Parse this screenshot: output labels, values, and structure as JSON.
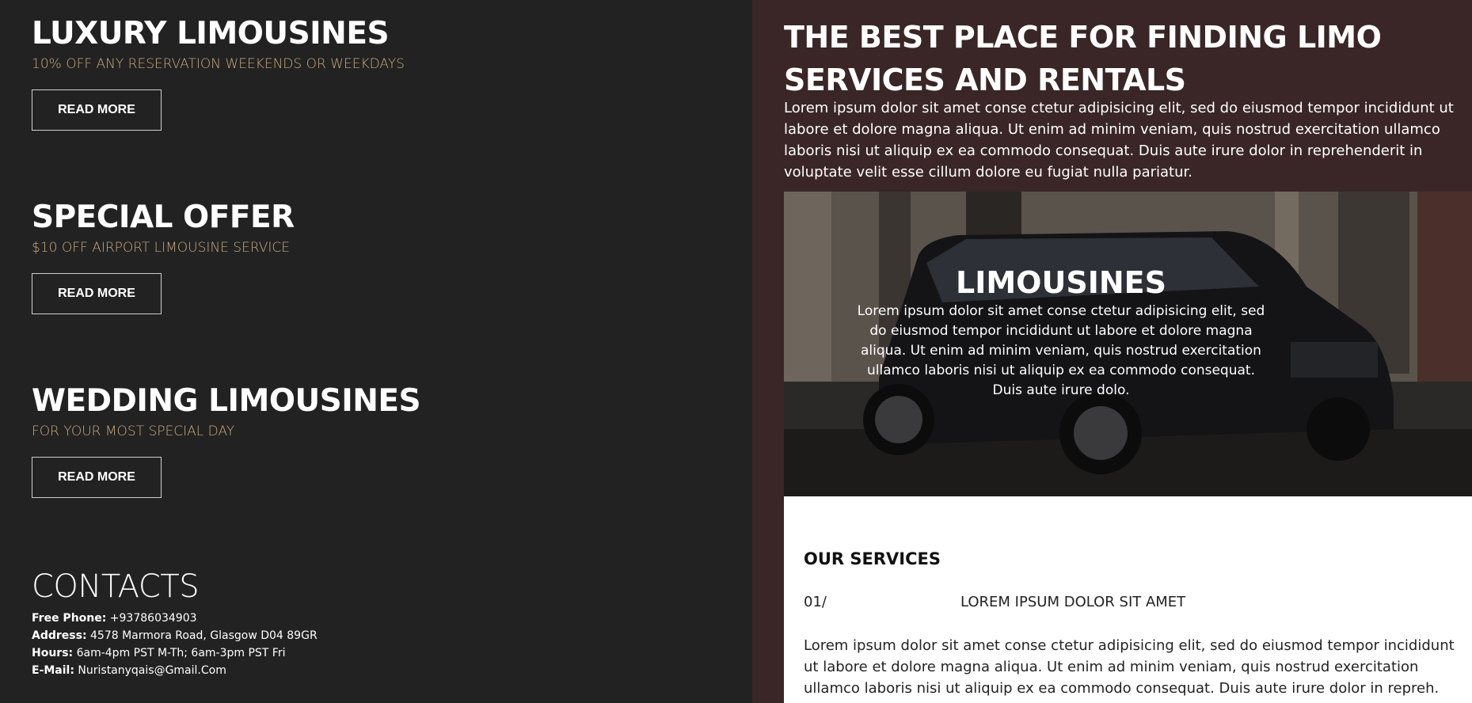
{
  "offers": [
    {
      "title": "LUXURY LIMOUSINES",
      "subtitle": "10% OFF ANY RESERVATION WEEKENDS OR WEEKDAYS",
      "button": "READ MORE"
    },
    {
      "title": "SPECIAL OFFER",
      "subtitle": "$10 OFF AIRPORT LIMOUSINE SERVICE",
      "button": "READ MORE"
    },
    {
      "title": "WEDDING LIMOUSINES",
      "subtitle": "FOR YOUR MOST SPECIAL DAY",
      "button": "READ MORE"
    }
  ],
  "contacts": {
    "heading": "CONTACTS",
    "phone_label": "Free Phone:",
    "phone": "+93786034903",
    "address_label": "Address:",
    "address": "4578 Marmora Road, Glasgow D04 89GR",
    "hours_label": "Hours:",
    "hours": "6am-4pm PST M-Th; 6am-3pm PST Fri",
    "email_label": "E-Mail:",
    "email": "Nuristanyqais@Gmail.Com"
  },
  "hero": {
    "title": "THE BEST PLACE FOR FINDING LIMO SERVICES AND RENTALS",
    "text": "Lorem ipsum dolor sit amet conse ctetur adipisicing elit, sed do eiusmod tempor incididunt ut labore et dolore magna aliqua. Ut enim ad minim veniam, quis nostrud exercitation ullamco laboris nisi ut aliquip ex ea commodo consequat. Duis aute irure dolor in reprehenderit in voluptate velit esse cillum dolore eu fugiat nulla pariatur."
  },
  "feature": {
    "title": "LIMOUSINES",
    "text": "Lorem ipsum dolor sit amet conse ctetur adipisicing elit, sed do eiusmod tempor incididunt ut labore et dolore magna aliqua. Ut enim ad minim veniam, quis nostrud exercitation ullamco laboris nisi ut aliquip ex ea commodo consequat. Duis aute irure dolo."
  },
  "services": {
    "heading": "OUR SERVICES",
    "items": [
      {
        "number": "01/",
        "title": "LOREM IPSUM DOLOR SIT AMET",
        "text": "Lorem ipsum dolor sit amet conse ctetur adipisicing elit, sed do eiusmod tempor incididunt ut labore et dolore magna aliqua. Ut enim ad minim veniam, quis nostrud exercitation ullamco laboris nisi ut aliquip ex ea commodo consequat. Duis aute irure dolor in repreh."
      }
    ]
  },
  "colors": {
    "left_bg": "#222222",
    "right_bg": "#3a2626",
    "accent_gold": "#c7a97d"
  }
}
